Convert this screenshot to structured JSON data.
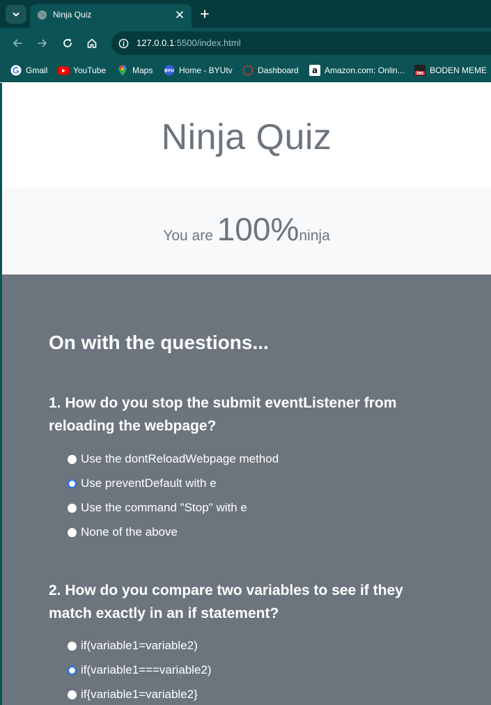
{
  "browser": {
    "tab": {
      "title": "Ninja Quiz"
    },
    "address_bar": {
      "url_host": "127.0.0.1",
      "url_rest": ":5500/index.html"
    },
    "bookmarks": [
      {
        "label": "Gmail",
        "icon": "google-icon"
      },
      {
        "label": "YouTube",
        "icon": "youtube-icon"
      },
      {
        "label": "Maps",
        "icon": "maps-pin-icon"
      },
      {
        "label": "Home - BYUtv",
        "icon": "byutv-icon"
      },
      {
        "label": "Dashboard",
        "icon": "dashboard-icon"
      },
      {
        "label": "Amazon.com: Onlin...",
        "icon": "amazon-icon"
      },
      {
        "label": "BODEN MEME",
        "icon": "imgflip-icon"
      }
    ]
  },
  "page": {
    "title": "Ninja Quiz",
    "result": {
      "prefix": "You are ",
      "score": "100%",
      "suffix": "ninja"
    },
    "quiz": {
      "heading": "On with the questions...",
      "questions": [
        {
          "text": "1. How do you stop the submit eventListener from reloading the webpage?",
          "options": [
            {
              "label": "Use the dontReloadWebpage method",
              "checked": false
            },
            {
              "label": "Use preventDefault with e",
              "checked": true
            },
            {
              "label": "Use the command \"Stop\" with e",
              "checked": false
            },
            {
              "label": "None of the above",
              "checked": false
            }
          ]
        },
        {
          "text": "2. How do you compare two variables to see if they match exactly in an if statement?",
          "options": [
            {
              "label": "if(variable1=variable2)",
              "checked": false
            },
            {
              "label": "if(variable1===variable2)",
              "checked": true
            },
            {
              "label": "if{variable1=variable2}",
              "checked": false
            }
          ]
        }
      ]
    }
  },
  "colors": {
    "chrome_dark": "#063b3d",
    "chrome": "#0c5355",
    "quiz_bg": "#6c757d",
    "result_bg": "#f8f9fa",
    "radio_checked": "#1a73e8"
  }
}
